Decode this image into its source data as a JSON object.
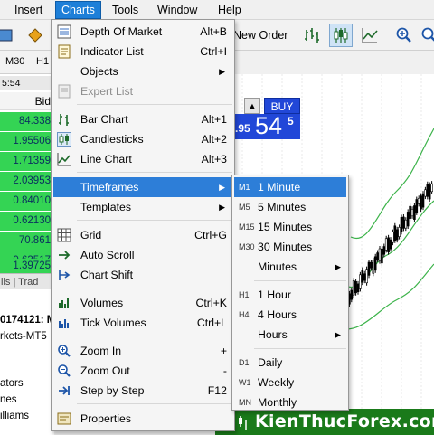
{
  "menubar": {
    "items": [
      {
        "label": "Insert"
      },
      {
        "label": "Charts"
      },
      {
        "label": "Tools"
      },
      {
        "label": "Window"
      },
      {
        "label": "Help"
      }
    ]
  },
  "toolbar": {
    "new_order_label": "New Order"
  },
  "timeframes_bar": {
    "items": [
      "M30",
      "H1"
    ]
  },
  "market_watch": {
    "time": "5:54",
    "column_bid": "Bid",
    "rows": [
      "84.338",
      "1.95506",
      "1.71359",
      "2.03953",
      "0.84010",
      "0.62130",
      "70.861",
      "0.63517",
      "1.39725"
    ]
  },
  "bottom_tabs": {
    "label": "ils | Trad"
  },
  "navigator": {
    "items": [
      "0174121: M",
      "rkets-MT5",
      "",
      "ators",
      "nes",
      "illiams"
    ]
  },
  "chart": {
    "buy_label": "BUY",
    "price_small": ".95",
    "price_big": "54",
    "price_sup": "5",
    "colors": {
      "candle": "#000000",
      "line": "#3cb34a",
      "buy_panel": "#2147d8"
    }
  },
  "watermark": {
    "text": "KienThucForex.com"
  },
  "charts_menu": {
    "items": [
      {
        "label": "Depth Of Market",
        "shortcut": "Alt+B",
        "icon": "depth-of-market-icon"
      },
      {
        "label": "Indicator List",
        "shortcut": "Ctrl+I",
        "icon": "indicator-list-icon"
      },
      {
        "label": "Objects",
        "shortcut": "",
        "icon": ""
      },
      {
        "label": "Expert List",
        "shortcut": "",
        "icon": "expert-list-icon"
      },
      {
        "label": "Bar Chart",
        "shortcut": "Alt+1",
        "icon": "bar-chart-icon"
      },
      {
        "label": "Candlesticks",
        "shortcut": "Alt+2",
        "icon": "candlesticks-icon"
      },
      {
        "label": "Line Chart",
        "shortcut": "Alt+3",
        "icon": "line-chart-icon"
      },
      {
        "label": "Timeframes",
        "shortcut": "",
        "icon": ""
      },
      {
        "label": "Templates",
        "shortcut": "",
        "icon": ""
      },
      {
        "label": "Grid",
        "shortcut": "Ctrl+G",
        "icon": "grid-icon"
      },
      {
        "label": "Auto Scroll",
        "shortcut": "",
        "icon": "auto-scroll-icon"
      },
      {
        "label": "Chart Shift",
        "shortcut": "",
        "icon": "chart-shift-icon"
      },
      {
        "label": "Volumes",
        "shortcut": "Ctrl+K",
        "icon": "volumes-icon"
      },
      {
        "label": "Tick Volumes",
        "shortcut": "Ctrl+L",
        "icon": "tick-volumes-icon"
      },
      {
        "label": "Zoom In",
        "shortcut": "+",
        "icon": "zoom-in-icon"
      },
      {
        "label": "Zoom Out",
        "shortcut": "-",
        "icon": "zoom-out-icon"
      },
      {
        "label": "Step by Step",
        "shortcut": "F12",
        "icon": "step-by-step-icon"
      },
      {
        "label": "Properties",
        "shortcut": "",
        "icon": "properties-icon"
      }
    ]
  },
  "timeframes_menu": {
    "items": [
      {
        "code": "M1",
        "label": "1 Minute"
      },
      {
        "code": "M5",
        "label": "5 Minutes"
      },
      {
        "code": "M15",
        "label": "15 Minutes"
      },
      {
        "code": "M30",
        "label": "30 Minutes"
      },
      {
        "code": "",
        "label": "Minutes"
      },
      {
        "code": "H1",
        "label": "1 Hour"
      },
      {
        "code": "H4",
        "label": "4 Hours"
      },
      {
        "code": "",
        "label": "Hours"
      },
      {
        "code": "D1",
        "label": "Daily"
      },
      {
        "code": "W1",
        "label": "Weekly"
      },
      {
        "code": "MN",
        "label": "Monthly"
      }
    ]
  }
}
